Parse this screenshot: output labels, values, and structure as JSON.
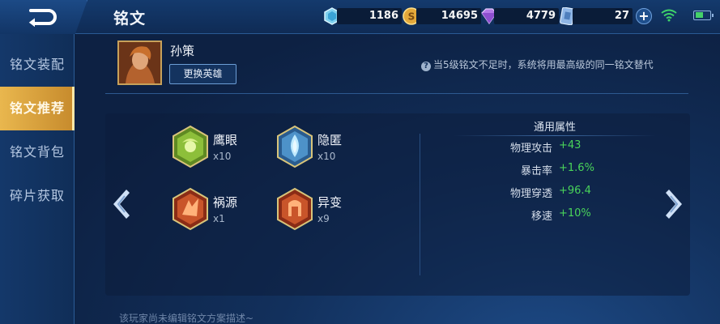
{
  "header": {
    "title": "铭文",
    "resources": [
      {
        "icon": "diamond-icon",
        "value": "1186"
      },
      {
        "icon": "gold-coin-icon",
        "value": "14695"
      },
      {
        "icon": "purple-crystal-icon",
        "value": "4779"
      },
      {
        "icon": "voucher-card-icon",
        "value": "27"
      }
    ],
    "accent": "#e9b74e"
  },
  "sidebar": {
    "items": [
      {
        "label": "铭文装配",
        "active": false
      },
      {
        "label": "铭文推荐",
        "active": true
      },
      {
        "label": "铭文背包",
        "active": false
      },
      {
        "label": "碎片获取",
        "active": false
      }
    ]
  },
  "hero": {
    "name": "孙策",
    "change_label": "更换英雄"
  },
  "tip": "当5级铭文不足时，系统将用最高级的同一铭文替代",
  "runes": [
    {
      "name": "鹰眼",
      "count": "x10",
      "color": "green"
    },
    {
      "name": "隐匿",
      "count": "x10",
      "color": "blue"
    },
    {
      "name": "祸源",
      "count": "x1",
      "color": "red"
    },
    {
      "name": "异变",
      "count": "x9",
      "color": "red"
    }
  ],
  "attributes": {
    "title": "通用属性",
    "rows": [
      {
        "key": "物理攻击",
        "value": "+43"
      },
      {
        "key": "暴击率",
        "value": "+1.6%"
      },
      {
        "key": "物理穿透",
        "value": "+96.4"
      },
      {
        "key": "移速",
        "value": "+10%"
      }
    ],
    "value_color": "#49d45a"
  },
  "description": "该玩家尚未编辑铭文方案描述~"
}
